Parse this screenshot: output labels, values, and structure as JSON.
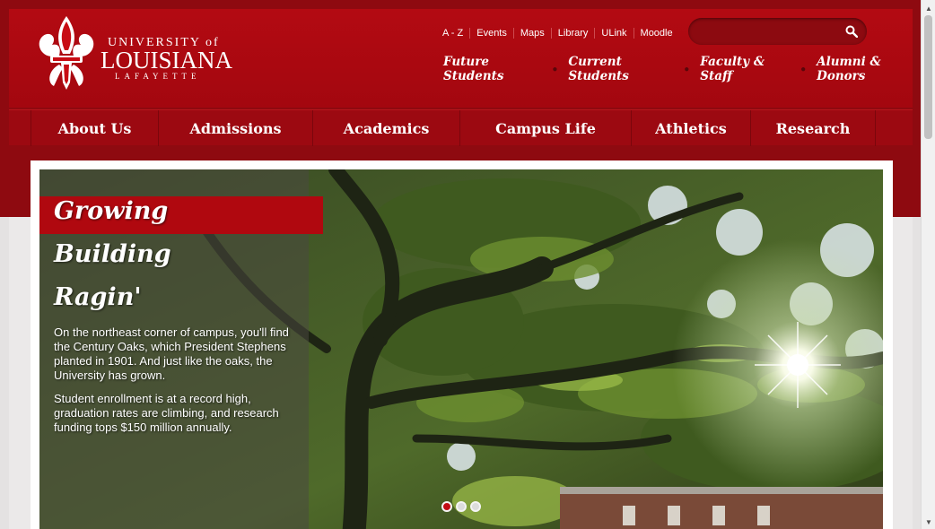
{
  "logo": {
    "university_of": "UNIVERSITY of",
    "louisiana": "LOUISIANA",
    "lafayette": "LAFAYETTE"
  },
  "utility_links": [
    "A - Z",
    "Events",
    "Maps",
    "Library",
    "ULink",
    "Moodle"
  ],
  "search": {
    "placeholder": "",
    "icon": "search-icon"
  },
  "audience_links": [
    "Future Students",
    "Current Students",
    "Faculty & Staff",
    "Alumni & Donors"
  ],
  "nav": [
    "About Us",
    "Admissions",
    "Academics",
    "Campus Life",
    "Athletics",
    "Research"
  ],
  "hero": {
    "headline_1": "Growing",
    "headline_2": "Building",
    "headline_3": "Ragin'",
    "paragraph_1": "On the northeast corner of campus, you'll find the Century Oaks, which President Stephens planted in 1901. And just like the oaks, the University has grown.",
    "paragraph_2": "Student enrollment is at a record high, graduation rates are climbing, and research funding tops $150 million annually.",
    "slide_count": 3,
    "active_slide": 1
  },
  "colors": {
    "brand_red": "#b30a12",
    "dark_red": "#8e0a10"
  }
}
